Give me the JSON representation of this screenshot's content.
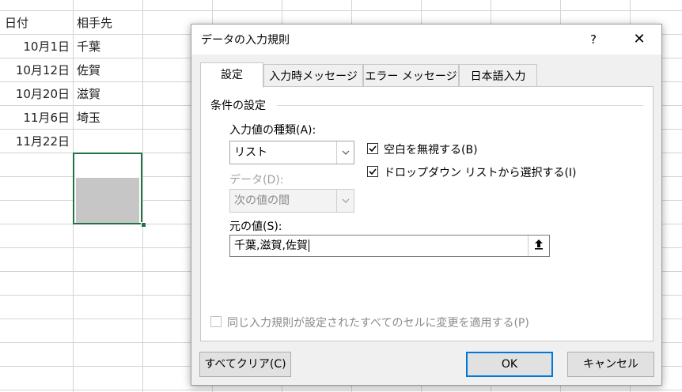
{
  "sheet": {
    "headers": {
      "date": "日付",
      "opponent": "相手先"
    },
    "rows": [
      {
        "date": "10月1日",
        "opponent": "千葉"
      },
      {
        "date": "10月12日",
        "opponent": "佐賀"
      },
      {
        "date": "10月20日",
        "opponent": "滋賀"
      },
      {
        "date": "11月6日",
        "opponent": "埼玉"
      },
      {
        "date": "11月22日",
        "opponent": ""
      }
    ]
  },
  "dialog": {
    "title": "データの入力規則",
    "help": "?",
    "close": "✕",
    "tabs": [
      {
        "label": "設定",
        "active": true
      },
      {
        "label": "入力時メッセージ",
        "active": false
      },
      {
        "label": "エラー メッセージ",
        "active": false
      },
      {
        "label": "日本語入力",
        "active": false
      }
    ],
    "group_label": "条件の設定",
    "allow_label": "入力値の種類(A):",
    "allow_value": "リスト",
    "data_label": "データ(D):",
    "data_value": "次の値の間",
    "ignore_blank": {
      "label": "空白を無視する(B)",
      "checked": true
    },
    "dropdown": {
      "label": "ドロップダウン リストから選択する(I)",
      "checked": true
    },
    "source_label": "元の値(S):",
    "source_value": "千葉,滋賀,佐賀",
    "apply_all": {
      "label": "同じ入力規則が設定されたすべてのセルに変更を適用する(P)",
      "checked": false
    },
    "buttons": {
      "clear_all": "すべてクリア(C)",
      "ok": "OK",
      "cancel": "キャンセル"
    }
  },
  "icons": {
    "dropdown_arrow": "chevron-down-icon",
    "checkmark": "checkmark-icon",
    "range_select": "range-select-icon"
  },
  "colors": {
    "selection_border": "#217346",
    "default_button_border": "#0078d7"
  }
}
